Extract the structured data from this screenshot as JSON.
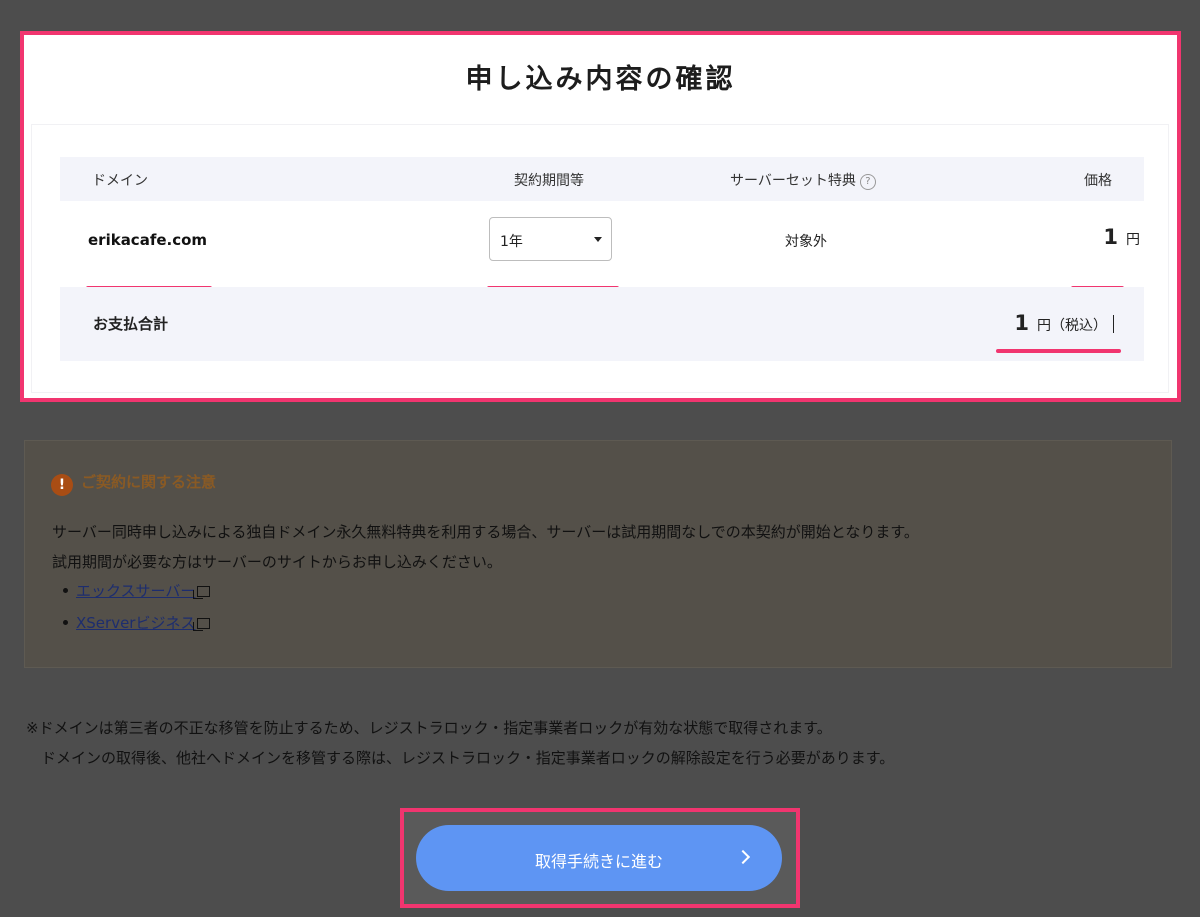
{
  "title": "申し込み内容の確認",
  "table": {
    "headers": {
      "domain": "ドメイン",
      "period": "契約期間等",
      "benefit": "サーバーセット特典",
      "price": "価格"
    },
    "help_icon_glyph": "?",
    "row": {
      "domain": "erikacafe.com",
      "period_value": "1年",
      "benefit": "対象外",
      "price": "1",
      "currency": "円"
    },
    "total": {
      "label": "お支払合計",
      "price": "1",
      "currency": "円",
      "tax_note": "（税込）"
    }
  },
  "notice": {
    "icon_glyph": "!",
    "title": "ご契約に関する注意",
    "lines": [
      "サーバー同時申し込みによる独自ドメイン永久無料特典を利用する場合、サーバーは試用期間なしでの本契約が開始となります。",
      "試用期間が必要な方はサーバーのサイトからお申し込みください。"
    ],
    "links": [
      "エックスサーバー",
      "XServerビジネス"
    ]
  },
  "footnote": [
    "※ドメインは第三者の不正な移管を防止するため、レジストラロック・指定事業者ロックが有効な状態で取得されます。",
    "　ドメインの取得後、他社へドメインを移管する際は、レジストラロック・指定事業者ロックの解除設定を行う必要があります。"
  ],
  "proceed_button": {
    "label": "取得手続きに進む"
  },
  "colors": {
    "highlight": "#f1356f",
    "button": "#5e95f3",
    "overlay": "#4d4d4d"
  }
}
